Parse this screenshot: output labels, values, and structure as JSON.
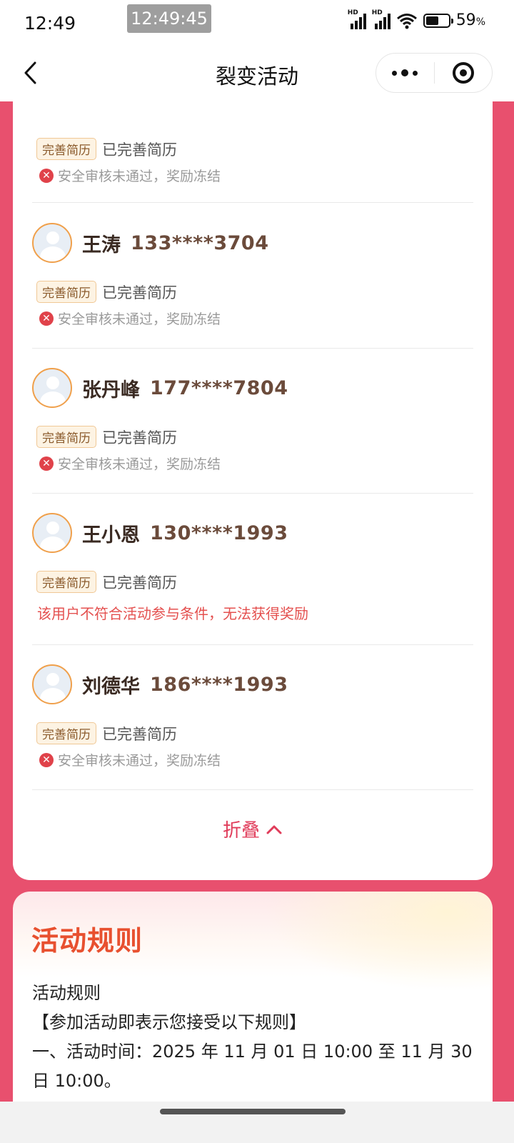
{
  "status_bar": {
    "time": "12:49",
    "overlay_time": "12:49:45",
    "signal_label": "HD",
    "battery_percent": 59,
    "battery_text": "59",
    "battery_unit": "%"
  },
  "nav": {
    "title": "裂变活动",
    "back_icon": "chevron-left-icon",
    "more_icon": "more-dots-icon",
    "close_icon": "target-circle-icon"
  },
  "invitees": [
    {
      "name": "",
      "phone": "",
      "tag": "完善简历",
      "tag_status": "已完善简历",
      "note": "安全审核未通过，奖励冻结",
      "note_type": "frozen"
    },
    {
      "name": "王涛",
      "phone": "133****3704",
      "tag": "完善简历",
      "tag_status": "已完善简历",
      "note": "安全审核未通过，奖励冻结",
      "note_type": "frozen"
    },
    {
      "name": "张丹峰",
      "phone": "177****7804",
      "tag": "完善简历",
      "tag_status": "已完善简历",
      "note": "安全审核未通过，奖励冻结",
      "note_type": "frozen"
    },
    {
      "name": "王小恩",
      "phone": "130****1993",
      "tag": "完善简历",
      "tag_status": "已完善简历",
      "note": "该用户不符合活动参与条件，无法获得奖励",
      "note_type": "ineligible"
    },
    {
      "name": "刘德华",
      "phone": "186****1993",
      "tag": "完善简历",
      "tag_status": "已完善简历",
      "note": "安全审核未通过，奖励冻结",
      "note_type": "frozen"
    }
  ],
  "collapse_label": "折叠",
  "rules": {
    "heading": "活动规则",
    "line1": "活动规则",
    "line2": "【参加活动即表示您接受以下规则】",
    "line3": "一、活动时间：2025 年 11 月 01 日 10:00 至 11 月 30",
    "line4": "日 10:00。"
  },
  "colors": {
    "page_bg": "#e8506e",
    "accent": "#e03c5a",
    "warn_red": "#e4504f",
    "rules_heading": "#e8502f"
  }
}
